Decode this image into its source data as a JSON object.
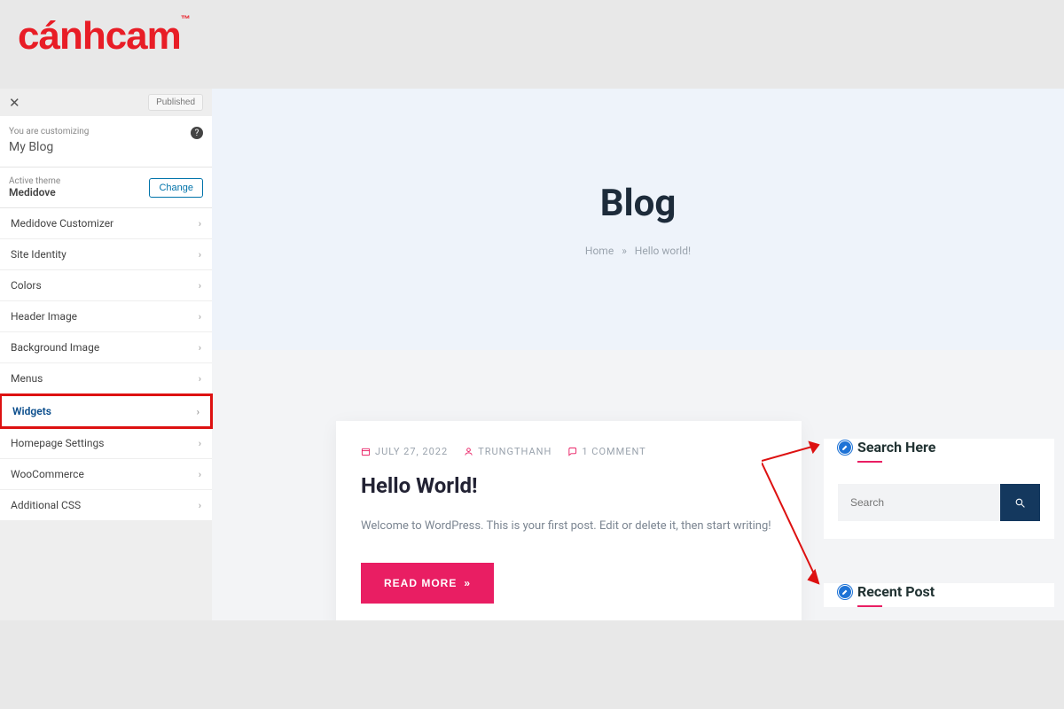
{
  "logo": {
    "text": "cánhcam",
    "tm": "™"
  },
  "sidebar": {
    "published_label": "Published",
    "you_are_customizing": "You are customizing",
    "blog_name": "My Blog",
    "active_theme_label": "Active theme",
    "active_theme_name": "Medidove",
    "change_label": "Change",
    "items": [
      {
        "label": "Medidove Customizer",
        "highlight": false
      },
      {
        "label": "Site Identity",
        "highlight": false
      },
      {
        "label": "Colors",
        "highlight": false
      },
      {
        "label": "Header Image",
        "highlight": false
      },
      {
        "label": "Background Image",
        "highlight": false
      },
      {
        "label": "Menus",
        "highlight": false
      },
      {
        "label": "Widgets",
        "highlight": true
      },
      {
        "label": "Homepage Settings",
        "highlight": false
      },
      {
        "label": "WooCommerce",
        "highlight": false
      },
      {
        "label": "Additional CSS",
        "highlight": false
      }
    ]
  },
  "hero": {
    "title": "Blog",
    "breadcrumb_home": "Home",
    "breadcrumb_sep": "»",
    "breadcrumb_current": "Hello world!"
  },
  "post": {
    "date": "JULY 27, 2022",
    "author": "TRUNGTHANH",
    "comments": "1 COMMENT",
    "title": "Hello World!",
    "excerpt": "Welcome to WordPress. This is your first post. Edit or delete it, then start writing!",
    "read_more": "READ MORE",
    "read_more_icon": "»"
  },
  "widgets": {
    "search": {
      "title": "Search Here",
      "placeholder": "Search"
    },
    "recent": {
      "title": "Recent Post"
    }
  }
}
